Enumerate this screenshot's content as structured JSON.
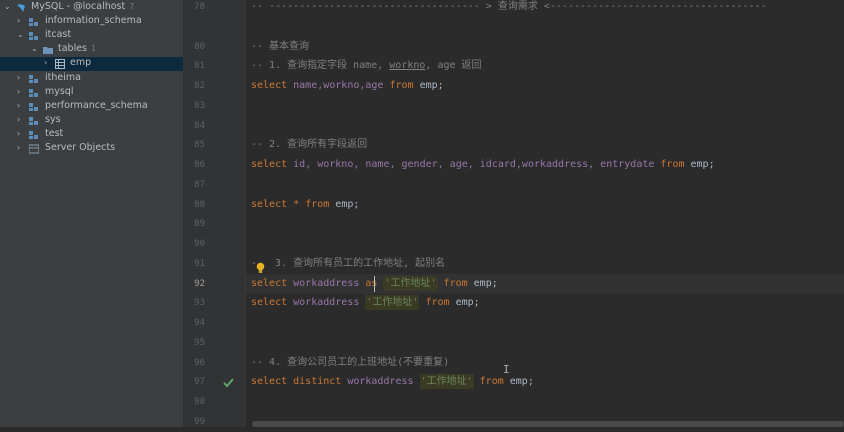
{
  "sidebar": {
    "connection": {
      "label": "MySQL - @localhost",
      "count": "7"
    },
    "items": [
      {
        "label": "information_schema"
      },
      {
        "label": "itcast"
      },
      {
        "label": "tables",
        "count": "1"
      },
      {
        "label": "emp"
      },
      {
        "label": "itheima"
      },
      {
        "label": "mysql"
      },
      {
        "label": "performance_schema"
      },
      {
        "label": "sys"
      },
      {
        "label": "test"
      },
      {
        "label": "Server Objects"
      }
    ]
  },
  "editor": {
    "line_numbers": [
      "78",
      "80",
      "81",
      "82",
      "83",
      "84",
      "85",
      "86",
      "87",
      "88",
      "89",
      "90",
      "91",
      "92",
      "93",
      "94",
      "95",
      "96",
      "97",
      "98",
      "99"
    ],
    "lines": {
      "l78": "-- ----------------------------------- > 查询需求 <------------------------------------",
      "l80": "-- 基本查询",
      "l81_a": "-- 1. 查询指定字段 name, ",
      "l81_b": "workno",
      "l81_c": ", age 返回",
      "l82_kw1": "select",
      "l82_cols": " name,workno,age ",
      "l82_kw2": "from",
      "l82_tbl": " emp;",
      "l85": "-- 2. 查询所有字段返回",
      "l86_kw1": "select",
      "l86_cols": " id, workno, name, gender, age, idcard,workaddress, entrydate ",
      "l86_kw2": "from",
      "l86_tbl": " emp;",
      "l88_kw1": "select",
      "l88_star": " * ",
      "l88_kw2": "from",
      "l88_tbl": " emp;",
      "l91_a": "-",
      "l91_b": " 3. 查询所有员工的工作地址, 起别名",
      "l92_kw1": "select",
      "l92_col": " workaddress ",
      "l92_as": "as",
      "l92_sp": " ",
      "l92_str": "'工作地址'",
      "l92_kw2": " from",
      "l92_tbl": " emp;",
      "l93_kw1": "select",
      "l93_col": " workaddress ",
      "l93_str": "'工作地址'",
      "l93_kw2": " from",
      "l93_tbl": " emp;",
      "l96": "-- 4. 查询公司员工的上班地址(不要重复)",
      "l97_kw1": "select",
      "l97_kw2": " distinct",
      "l97_col": " workaddress ",
      "l97_str": "'工作地址'",
      "l97_kw3": " from",
      "l97_tbl": " emp;"
    }
  },
  "colors": {
    "keyword": "#cc7832",
    "comment": "#808080",
    "string": "#6a8759",
    "identifier": "#a9b7c6",
    "selection": "#0d293e"
  }
}
